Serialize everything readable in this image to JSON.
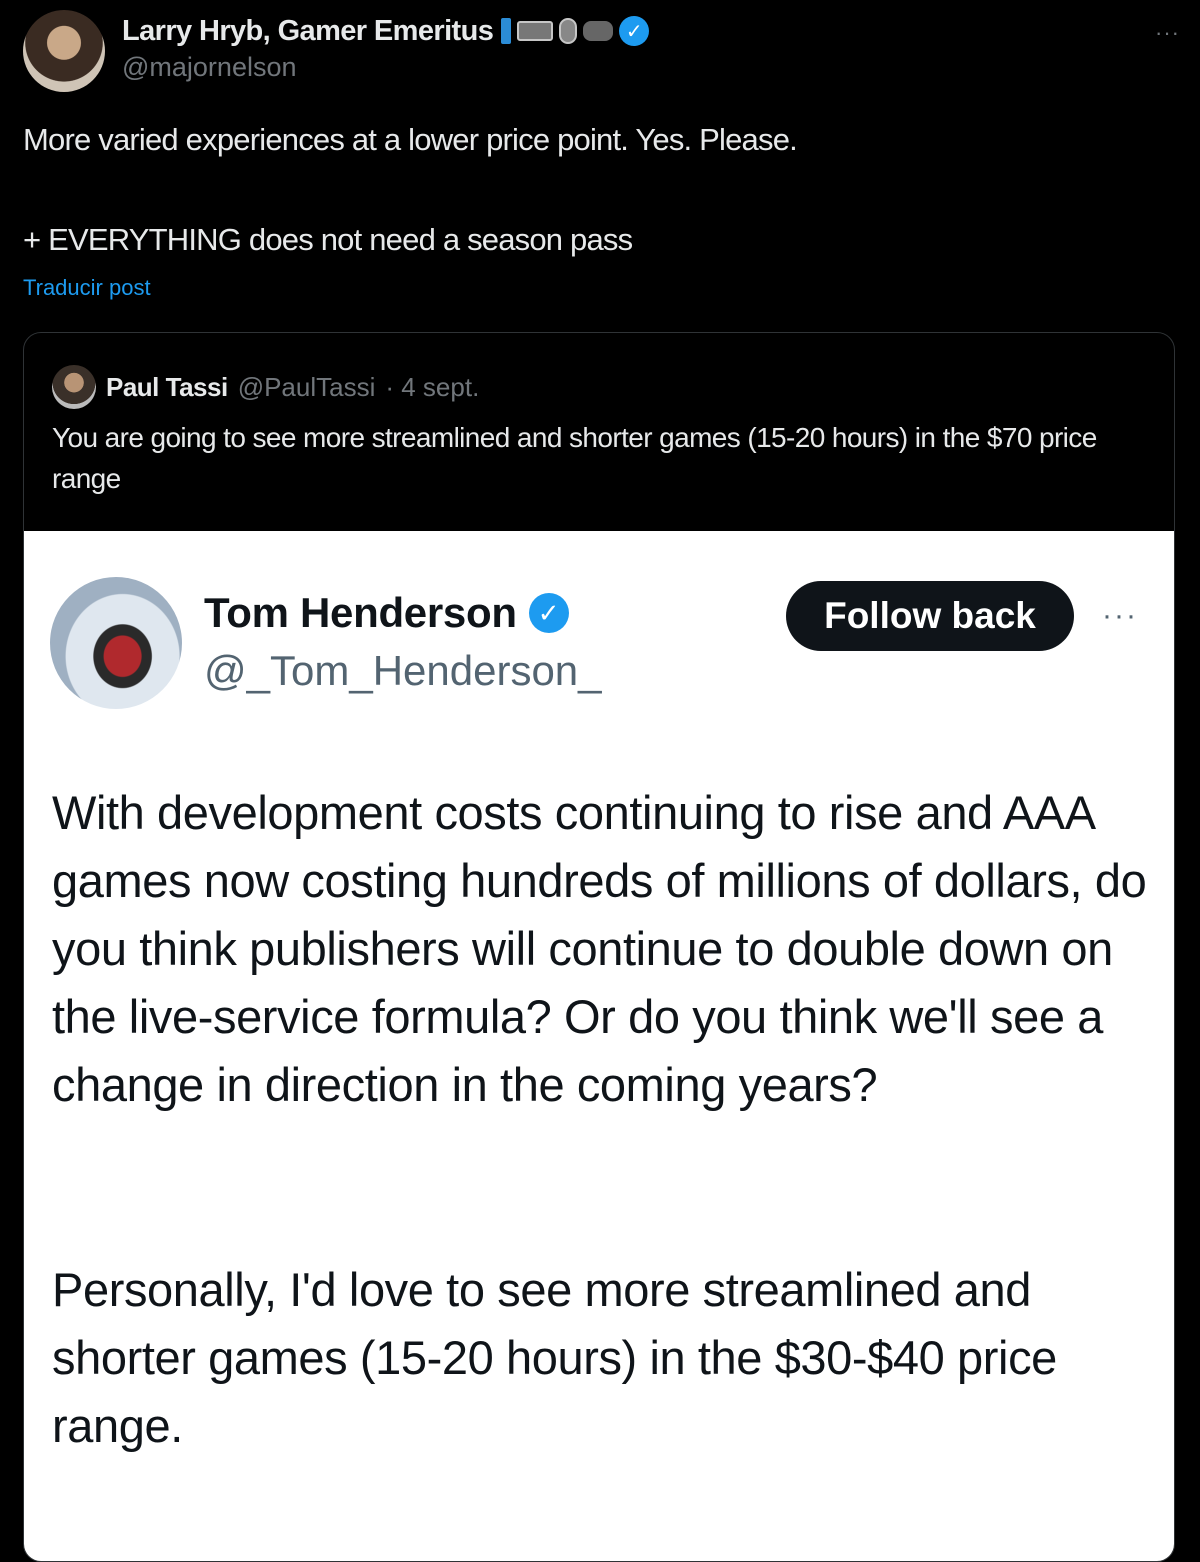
{
  "post": {
    "author": {
      "display_name": "Larry Hryb, Gamer Emeritus",
      "handle": "@majornelson",
      "badges": [
        "phone-icon",
        "keyboard-icon",
        "mouse-icon",
        "gamepad-icon",
        "verified-icon"
      ]
    },
    "more_label": "···",
    "text_line1": "More varied experiences at a lower price point. Yes. Please.",
    "text_line2": "+ EVERYTHING does not need a season pass",
    "translate_label": "Traducir post"
  },
  "quote": {
    "author": {
      "display_name": "Paul Tassi",
      "handle": "@PaulTassi",
      "date": "· 4 sept."
    },
    "text": "You are going to see more streamlined and shorter games (15-20 hours) in the $70 price range",
    "embedded_screenshot": {
      "author": {
        "display_name": "Tom Henderson",
        "handle": "@_Tom_Henderson_"
      },
      "follow_label": "Follow back",
      "more_label": "···",
      "paragraph1": "With development costs continuing to rise and AAA games now costing hundreds of millions of dollars, do you think publishers will continue to double down on the live-service formula? Or do you think we'll see a change in direction in the coming years?",
      "paragraph2": "Personally, I'd love to see more streamlined and shorter games (15-20 hours) in the $30-$40 price range."
    }
  },
  "colors": {
    "background": "#000000",
    "text": "#e7e9ea",
    "muted": "#71767b",
    "link": "#1d9bf0",
    "verified": "#1d9bf0"
  }
}
